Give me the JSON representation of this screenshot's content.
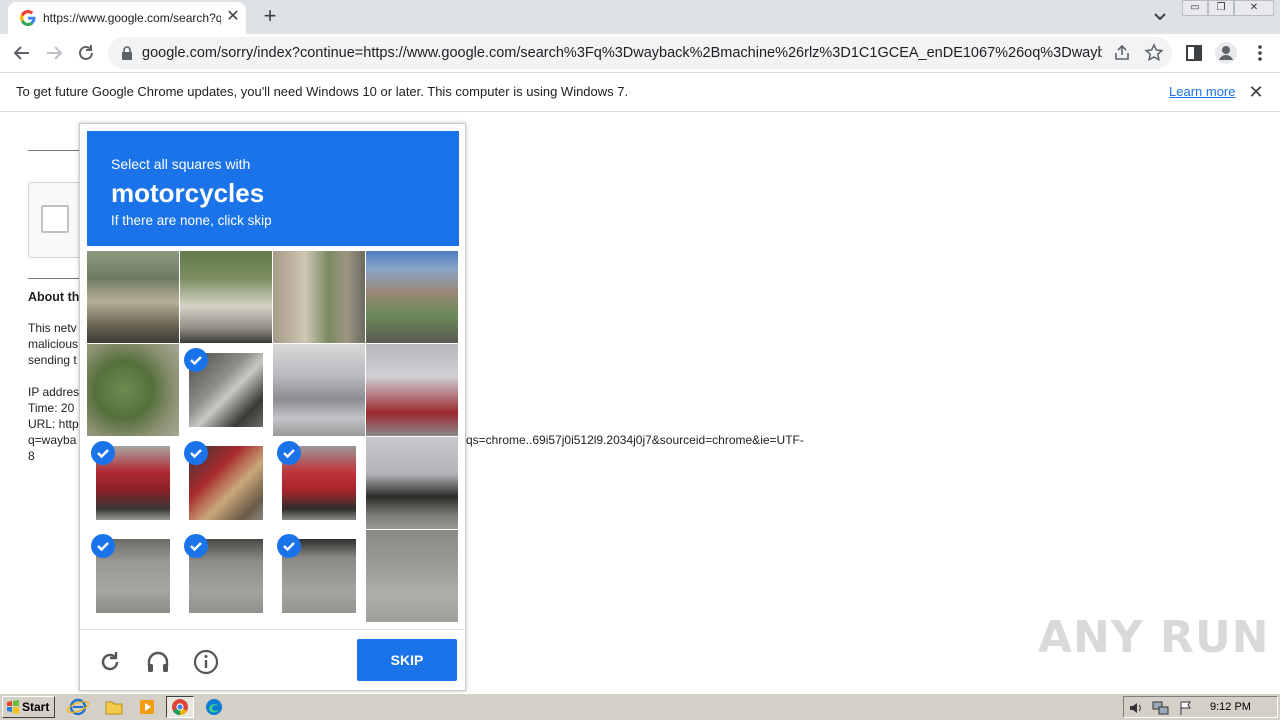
{
  "tab": {
    "title": "https://www.google.com/search?q=",
    "close": "✕",
    "new_tab": "+"
  },
  "toolbar": {
    "url": "google.com/sorry/index?continue=https://www.google.com/search%3Fq%3Dwayback%2Bmachine%26rlz%3D1C1GCEA_enDE1067%26oq%3Dwayba..."
  },
  "infobar": {
    "message": "To get future Google Chrome updates, you'll need Windows 10 or later. This computer is using Windows 7.",
    "learn_more": "Learn more",
    "close": "✕"
  },
  "page": {
    "about_heading": "About th",
    "para_lines": [
      "This netv",
      "malicious",
      "sending t"
    ],
    "ip_line": "IP addres",
    "time_line": "Time: 20",
    "url_line": "URL: http",
    "q_line": "q=wayba",
    "url_tail": "qs=chrome..69i57j0i512l9.2034j0j7&sourceid=chrome&ie=UTF-",
    "eight": "8"
  },
  "challenge": {
    "instruction": "Select all squares with",
    "target": "motorcycles",
    "hint": "If there are none, click skip",
    "skip_label": "SKIP",
    "tiles": [
      {
        "selected": false
      },
      {
        "selected": false
      },
      {
        "selected": false
      },
      {
        "selected": false
      },
      {
        "selected": false
      },
      {
        "selected": true
      },
      {
        "selected": false
      },
      {
        "selected": false
      },
      {
        "selected": true
      },
      {
        "selected": true
      },
      {
        "selected": true
      },
      {
        "selected": false
      },
      {
        "selected": true
      },
      {
        "selected": true
      },
      {
        "selected": true
      },
      {
        "selected": false
      }
    ]
  },
  "watermark": "ANY RUN",
  "taskbar": {
    "start_label": "Start",
    "clock": "9:12 PM"
  },
  "colors": {
    "accent": "#1a73e8",
    "taskbar": "#d4d0c8"
  }
}
